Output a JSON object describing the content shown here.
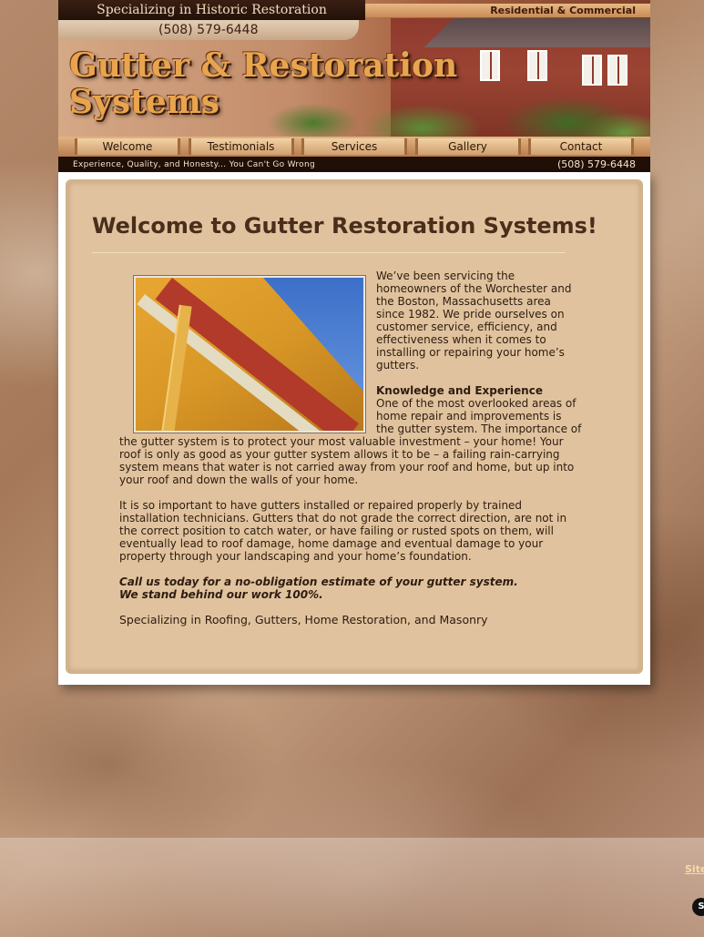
{
  "header": {
    "banner_left": "Specializing in Historic Restoration",
    "phone_top": "(508) 579-6448",
    "banner_right": "Residential & Commercial",
    "title_line1": "Gutter & Restoration",
    "title_line2": "Systems"
  },
  "nav": {
    "items": [
      {
        "label": "Welcome"
      },
      {
        "label": "Testimonials"
      },
      {
        "label": "Services"
      },
      {
        "label": "Gallery"
      },
      {
        "label": "Contact"
      }
    ]
  },
  "tagline": {
    "text": "Experience, Quality, and Honesty... You Can't Go Wrong",
    "phone": "(508) 579-6448"
  },
  "main": {
    "heading": "Welcome to Gutter Restoration Systems!",
    "intro": "We’ve been servicing the homeowners of the Worchester and the Boston, Massachusetts area since 1982. We pride ourselves on customer service, efficiency, and effectiveness when it comes to installing or repairing your home’s gutters.",
    "subheading": "Knowledge and Experience",
    "knowledge": "One of the most overlooked areas of home repair and improvements is the gutter system. The importance of the gutter system is to protect your most valuable investment – your home! Your roof is only as good as your gutter system allows it to be – a failing rain-carrying system means that water is not carried away from your roof and home, but up into your roof and down the walls of your home.",
    "importance": "It is so important to have gutters installed or repaired properly by trained installation technicians. Gutters that do not grade the correct direction, are not in the correct position to catch water, or have failing or rusted spots on them, will eventually lead to roof damage, home damage and eventual damage to your property through your landscaping and your home’s foundation.",
    "callout_line1": "Call us today for a no-obligation estimate of your gutter system.",
    "callout_line2": "We stand behind our work 100%.",
    "specializing": "Specializing in Roofing, Gutters, Home Restoration, and Masonry"
  },
  "footer": {
    "sitemap_label": "Site",
    "badge": "S"
  }
}
